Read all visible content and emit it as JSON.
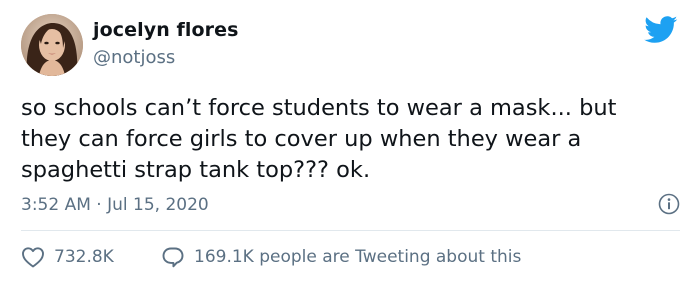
{
  "tweet": {
    "display_name": "jocelyn flores",
    "handle": "@notjoss",
    "body": "so schools can’t force students to wear a mask... but\nthey can force girls to cover up when they wear a\nspaghetti strap tank top??? ok.",
    "timestamp": "3:52 AM · Jul 15, 2020",
    "likes": "732.8K",
    "tweeting_about": "169.1K people are Tweeting about this"
  },
  "icons": {
    "brand": "twitter-bird-icon",
    "info": "info-icon",
    "like": "heart-icon",
    "conversation": "speech-bubble-icon"
  },
  "colors": {
    "brand_blue": "#1da1f2",
    "text_primary": "#0f1419",
    "text_secondary": "#5b7083",
    "divider": "#e1e8ed"
  }
}
